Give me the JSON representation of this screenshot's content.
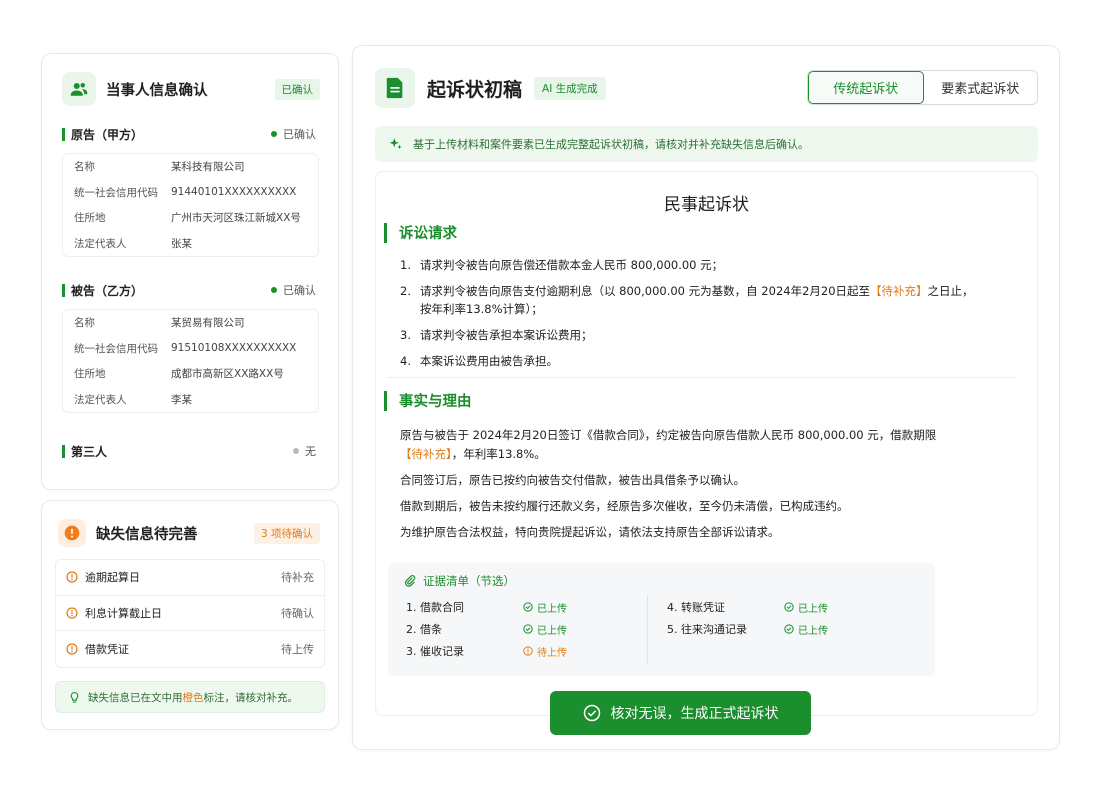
{
  "party_card": {
    "title": "当事人信息确认",
    "badge": "已确认",
    "plaintiff": {
      "heading": "原告（甲方）",
      "status": "已确认",
      "rows": [
        {
          "key": "名称",
          "value": "某科技有限公司"
        },
        {
          "key": "统一社会信用代码",
          "value": "91440101XXXXXXXXXX"
        },
        {
          "key": "住所地",
          "value": "广州市天河区珠江新城XX号"
        },
        {
          "key": "法定代表人",
          "value": "张某"
        }
      ]
    },
    "defendant": {
      "heading": "被告（乙方）",
      "status": "已确认",
      "rows": [
        {
          "key": "名称",
          "value": "某贸易有限公司"
        },
        {
          "key": "统一社会信用代码",
          "value": "91510108XXXXXXXXXX"
        },
        {
          "key": "住所地",
          "value": "成都市高新区XX路XX号"
        },
        {
          "key": "法定代表人",
          "value": "李某"
        }
      ]
    },
    "third_party": {
      "heading": "第三人",
      "status": "无"
    }
  },
  "missing_card": {
    "title": "缺失信息待完善",
    "badge": "3 项待确认",
    "items": [
      {
        "label": "逾期起算日",
        "status": "待补充"
      },
      {
        "label": "利息计算截止日",
        "status": "待确认"
      },
      {
        "label": "借款凭证",
        "status": "待上传"
      }
    ],
    "hint_prefix": "缺失信息已在文中用",
    "hint_highlight": "橙色",
    "hint_suffix": "标注，请核对补充。"
  },
  "main": {
    "title": "起诉状初稿",
    "ai_tag": "AI 生成完成",
    "tabs": [
      "传统起诉状",
      "要素式起诉状"
    ],
    "banner": "基于上传材料和案件要素已生成完整起诉状初稿，请核对并补充缺失信息后确认。",
    "doc_title": "民事起诉状",
    "claims_heading": "诉讼请求",
    "claims": {
      "c1": "请求判令被告向原告偿还借款本金人民币 800,000.00 元；",
      "c2_a": "请求判令被告向原告支付逾期利息（以 800,000.00 元为基数，自 2024年2月20日起至",
      "c2_pending": "【待补充】",
      "c2_b": "之日止，",
      "c2_c": "按年利率13.8%计算）；",
      "c3": "请求判令被告承担本案诉讼费用；",
      "c4": "本案诉讼费用由被告承担。"
    },
    "facts_heading": "事实与理由",
    "facts": {
      "p1_a": "原告与被告于 2024年2月20日签订《借款合同》，约定被告向原告借款人民币 800,000.00 元，借款期限",
      "p1_pending": "【待补充】",
      "p1_b": "，年利率13.8%。",
      "p2": "合同签订后，原告已按约向被告交付借款，被告出具借条予以确认。",
      "p3": "借款到期后，被告未按约履行还款义务，经原告多次催收，至今仍未清偿，已构成违约。",
      "p4": "为维护原告合法权益，特向贵院提起诉讼，请依法支持原告全部诉讼请求。"
    },
    "evidence": {
      "title": "证据清单（节选）",
      "left": [
        {
          "num": "1.",
          "name": "借款合同",
          "status": "已上传",
          "state": "ok"
        },
        {
          "num": "2.",
          "name": "借条",
          "status": "已上传",
          "state": "ok"
        },
        {
          "num": "3.",
          "name": "催收记录",
          "status": "待上传",
          "state": "warn"
        }
      ],
      "right": [
        {
          "num": "4.",
          "name": "转账凭证",
          "status": "已上传",
          "state": "ok"
        },
        {
          "num": "5.",
          "name": "往来沟通记录",
          "status": "已上传",
          "state": "ok"
        }
      ]
    },
    "confirm_button": "核对无误，生成正式起诉状"
  },
  "colors": {
    "brand_green": "#1b8e2d",
    "pending_orange": "#e07b16"
  }
}
